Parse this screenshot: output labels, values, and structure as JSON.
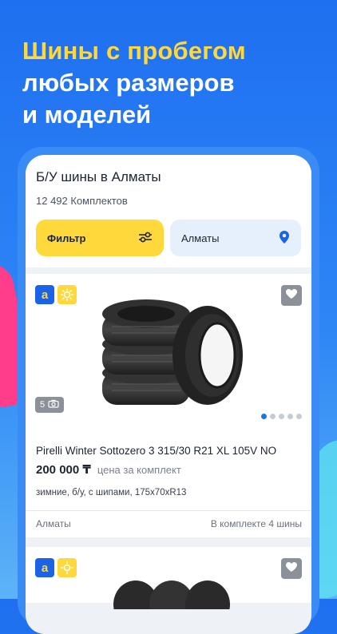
{
  "promo": {
    "line1": "Шины с пробегом",
    "line2": "любых размеров",
    "line3": "и моделей"
  },
  "header": {
    "title": "Б/У шины в Алматы",
    "count": "12 492 Комплектов"
  },
  "filters": {
    "filter_label": "Фильтр",
    "city_label": "Алматы"
  },
  "listing": {
    "badge_a": "a",
    "photo_count": "5",
    "name": "Pirelli Winter Sottozero 3 315/30 R21 XL 105V NO",
    "price": "200 000 ₸",
    "price_unit": "цена за комплект",
    "description": "зимние, б/у, с шипами, 175x70xR13",
    "city": "Алматы",
    "set_info": "В комплекте 4 шины",
    "gallery_dots": 5,
    "active_dot": 0
  },
  "listing2": {
    "badge_a": "a"
  },
  "colors": {
    "brand_blue": "#1f6ff0",
    "accent_yellow": "#ffd93b",
    "text_dark": "#1d2430"
  },
  "icons": [
    "filter-sliders-icon",
    "location-pin-icon",
    "heart-icon",
    "camera-icon",
    "sun-icon",
    "brand-a-icon"
  ]
}
